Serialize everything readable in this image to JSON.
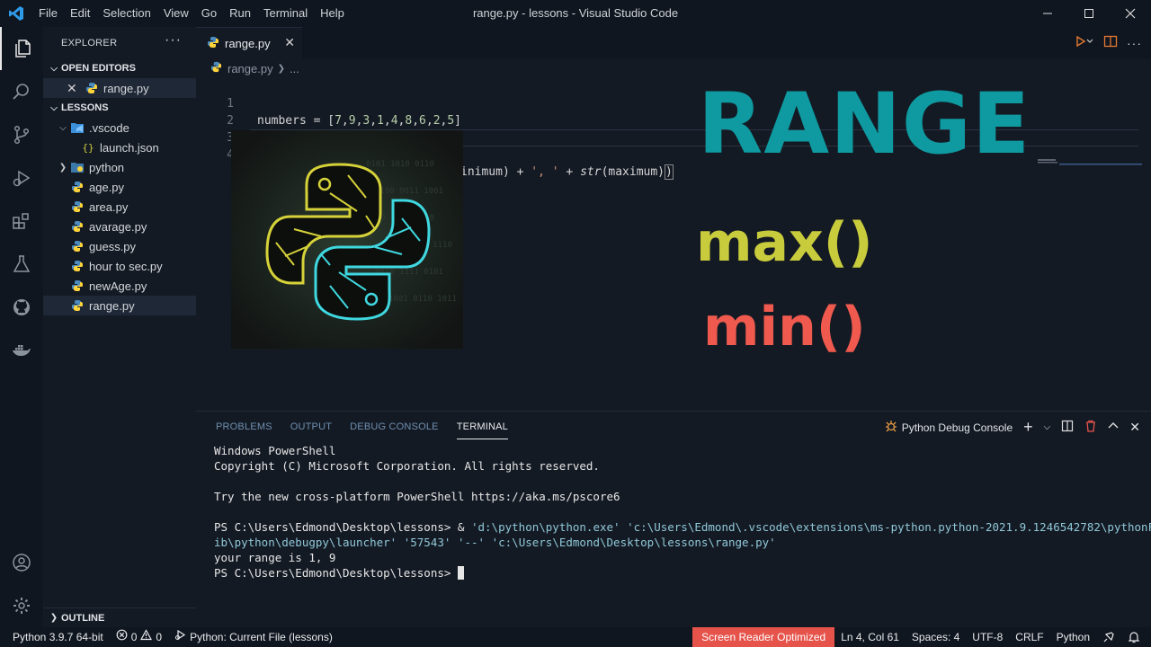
{
  "window": {
    "title": "range.py - lessons - Visual Studio Code"
  },
  "menu": [
    "File",
    "Edit",
    "Selection",
    "View",
    "Go",
    "Run",
    "Terminal",
    "Help"
  ],
  "sidebar": {
    "title": "EXPLORER",
    "open_editors_label": "OPEN EDITORS",
    "open_editors": [
      {
        "label": "range.py"
      }
    ],
    "folder_label": "LESSONS",
    "tree": [
      {
        "label": ".vscode",
        "type": "folder-open"
      },
      {
        "label": "launch.json",
        "type": "json"
      },
      {
        "label": "python",
        "type": "folder"
      },
      {
        "label": "age.py",
        "type": "py"
      },
      {
        "label": "area.py",
        "type": "py"
      },
      {
        "label": "avarage.py",
        "type": "py"
      },
      {
        "label": "guess.py",
        "type": "py"
      },
      {
        "label": "hour to sec.py",
        "type": "py"
      },
      {
        "label": "newAge.py",
        "type": "py"
      },
      {
        "label": "range.py",
        "type": "py"
      }
    ],
    "outline_label": "OUTLINE"
  },
  "editor": {
    "tab_label": "range.py",
    "breadcrumb_file": "range.py",
    "breadcrumb_more": "...",
    "line_numbers": [
      "1",
      "2",
      "3",
      "4"
    ],
    "line4_visible": "inimum) + ', ' + str(maximum))"
  },
  "overlay": {
    "title": "RANGE",
    "max_label": "max()",
    "min_label": "min()"
  },
  "panel": {
    "tabs": [
      "PROBLEMS",
      "OUTPUT",
      "DEBUG CONSOLE",
      "TERMINAL"
    ],
    "active_tab": "TERMINAL",
    "debug_console_label": "Python Debug Console",
    "terminal_lines": [
      "Windows PowerShell",
      "Copyright (C) Microsoft Corporation. All rights reserved.",
      "",
      "Try the new cross-platform PowerShell https://aka.ms/pscore6",
      ""
    ],
    "prompt1": "PS C:\\Users\\Edmond\\Desktop\\lessons>",
    "cmd_amp": " & ",
    "cmd_exe": "'d:\\python\\python.exe'",
    "cmd_launcher_a": "'c:\\Users\\Edmond\\.vscode\\extensions\\ms-python.python-2021.9.1246542782\\pythonFiles\\l",
    "cmd_launcher_b": "ib\\python\\debugpy\\launcher'",
    "cmd_port": "'57543'",
    "cmd_dash": "'--'",
    "cmd_file": "'c:\\Users\\Edmond\\Desktop\\lessons\\range.py'",
    "output": "your range is 1, 9",
    "prompt2": "PS C:\\Users\\Edmond\\Desktop\\lessons>"
  },
  "statusbar": {
    "interpreter": "Python 3.9.7 64-bit",
    "errors": "0",
    "warnings": "0",
    "run_config": "Python: Current File (lessons)",
    "screen_reader": "Screen Reader Optimized",
    "position": "Ln 4, Col 61",
    "spaces": "Spaces: 4",
    "encoding": "UTF-8",
    "eol": "CRLF",
    "language": "Python"
  },
  "colors": {
    "accent_range": "#0e9aa0",
    "accent_max": "#c8cb3c",
    "accent_min": "#f05a4e",
    "screen_reader_bg": "#e5534b"
  }
}
